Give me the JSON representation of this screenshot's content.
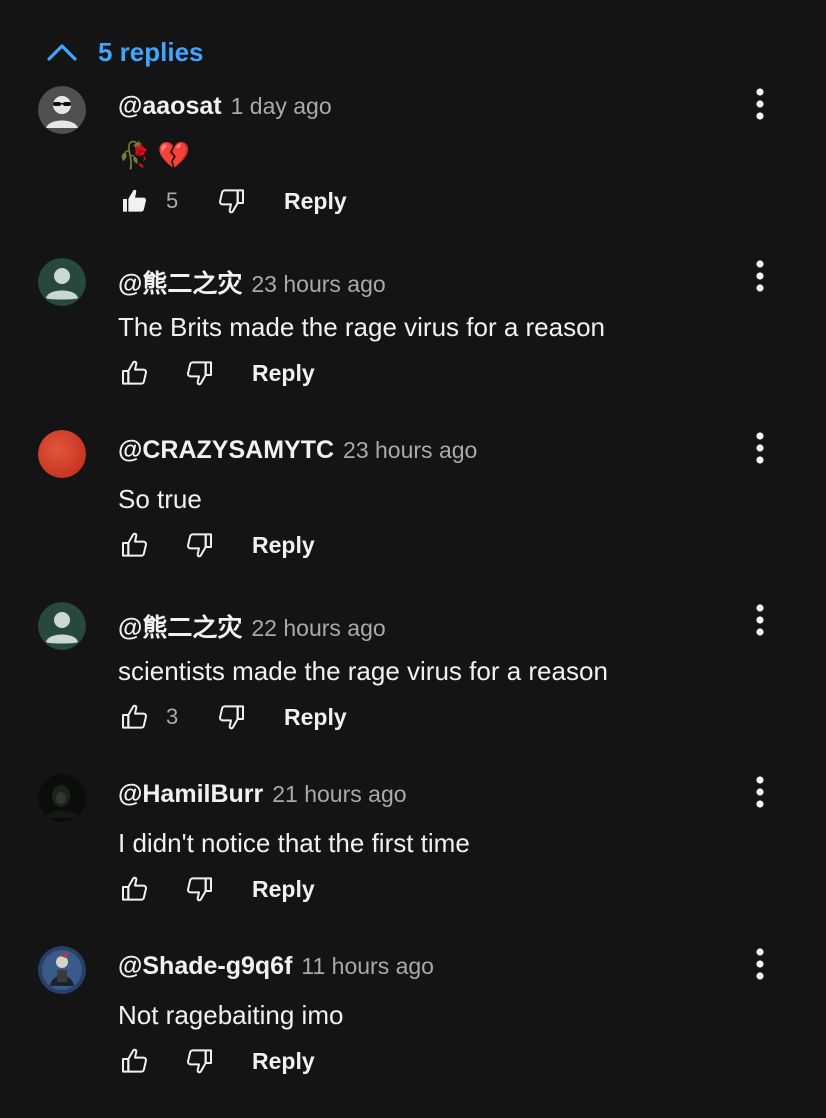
{
  "replies_toggle": {
    "label": "5 replies",
    "icon": "chevron-up-icon",
    "color": "#3ea6ff"
  },
  "comments": [
    {
      "author": "@aaosat",
      "time": "1 day ago",
      "text": "🥀 💔",
      "likes": "5",
      "liked": true,
      "reply_label": "Reply",
      "avatar": "sunglasses-avatar"
    },
    {
      "author": "@熊二之灾",
      "time": "23 hours ago",
      "text": "The Brits made the rage virus for a reason",
      "likes": "",
      "liked": false,
      "reply_label": "Reply",
      "avatar": "default-person-avatar"
    },
    {
      "author": "@CRAZYSAMYTC",
      "time": "23 hours ago",
      "text": "So true",
      "likes": "",
      "liked": false,
      "reply_label": "Reply",
      "avatar": "red-circle-avatar"
    },
    {
      "author": "@熊二之灾",
      "time": "22 hours ago",
      "text": "scientists made the rage virus for a reason",
      "likes": "3",
      "liked": false,
      "reply_label": "Reply",
      "avatar": "default-person-avatar"
    },
    {
      "author": "@HamilBurr",
      "time": "21 hours ago",
      "text": "I didn't notice that the first time",
      "likes": "",
      "liked": false,
      "reply_label": "Reply",
      "avatar": "dark-figure-avatar"
    },
    {
      "author": "@Shade-g9q6f",
      "time": "11 hours ago",
      "text": "Not ragebaiting imo",
      "likes": "",
      "liked": false,
      "reply_label": "Reply",
      "avatar": "character-avatar"
    }
  ]
}
